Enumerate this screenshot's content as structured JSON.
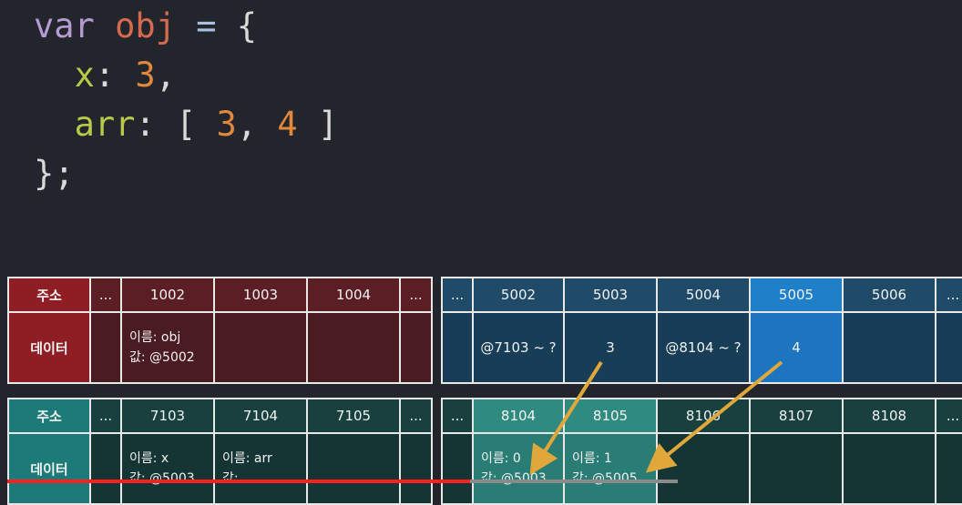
{
  "code": {
    "line1": {
      "kw": "var",
      "name": "obj",
      "op": "=",
      "brace": "{"
    },
    "line2": {
      "prop": "x",
      "colon": ":",
      "num": "3",
      "comma": ","
    },
    "line3": {
      "prop": "arr",
      "colon": ":",
      "open": "[",
      "n1": "3",
      "sep": ",",
      "n2": "4",
      "close": "]"
    },
    "line4": {
      "end": "};"
    }
  },
  "tableA": {
    "label_addr": "주소",
    "label_data": "데이터",
    "dots": "...",
    "addrs": [
      "1002",
      "1003",
      "1004"
    ],
    "cell1_name": "이름: obj",
    "cell1_val": "값: @5002"
  },
  "tableB": {
    "dots": "...",
    "addrs": [
      "5002",
      "5003",
      "5004",
      "5005",
      "5006"
    ],
    "data": [
      "@7103 ~ ?",
      "3",
      "@8104 ~ ?",
      "4",
      ""
    ]
  },
  "tableC": {
    "label_addr": "주소",
    "label_data": "데이터",
    "dots": "...",
    "addrs": [
      "7103",
      "7104",
      "7105"
    ],
    "cell1_name": "이름: x",
    "cell1_val": "값: @5003",
    "cell2_name": "이름: arr",
    "cell2_val": "값:"
  },
  "tableD": {
    "dots": "...",
    "addrs": [
      "8104",
      "8105",
      "8106",
      "8107",
      "8108"
    ],
    "cell1_name": "이름: 0",
    "cell1_val": "값: @5003",
    "cell2_name": "이름: 1",
    "cell2_val": "값: @5005"
  },
  "colors": {
    "arrow": "#e0a83a",
    "progress": "#ff1f1f"
  },
  "progress": 0.69
}
